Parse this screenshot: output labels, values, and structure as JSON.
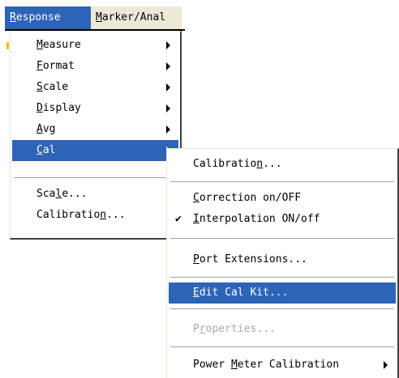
{
  "menubar": {
    "response": {
      "prefix": "",
      "accel": "R",
      "rest": "esponse"
    },
    "marker": {
      "prefix": "",
      "accel": "M",
      "rest": "arker/Anal"
    }
  },
  "response_menu": {
    "items": [
      {
        "prefix": "",
        "accel": "M",
        "rest": "easure",
        "submenu": true
      },
      {
        "prefix": "",
        "accel": "F",
        "rest": "ormat",
        "submenu": true
      },
      {
        "prefix": "",
        "accel": "S",
        "rest": "cale",
        "submenu": true
      },
      {
        "prefix": "",
        "accel": "D",
        "rest": "isplay",
        "submenu": true
      },
      {
        "prefix": "",
        "accel": "A",
        "rest": "vg",
        "submenu": true
      },
      {
        "prefix": "",
        "accel": "C",
        "rest": "al",
        "submenu": true,
        "highlighted": true
      },
      {
        "prefix": "Sca",
        "accel": "l",
        "rest": "e..."
      },
      {
        "prefix": "Calibratio",
        "accel": "n",
        "rest": "..."
      }
    ]
  },
  "cal_submenu": {
    "items": [
      {
        "prefix": "Calibratio",
        "accel": "n",
        "rest": "..."
      },
      {
        "prefix": "",
        "accel": "C",
        "rest": "orrection on/OFF"
      },
      {
        "prefix": "",
        "accel": "I",
        "rest": "nterpolation ON/off",
        "checked": true,
        "check_glyph": "✔"
      },
      {
        "prefix": "",
        "accel": "P",
        "rest": "ort Extensions..."
      },
      {
        "prefix": "",
        "accel": "E",
        "rest": "dit Cal Kit...",
        "highlighted": true
      },
      {
        "prefix": "P",
        "accel": "r",
        "rest": "operties...",
        "disabled": true
      },
      {
        "prefix": "Power ",
        "accel": "M",
        "rest": "eter Calibration",
        "submenu": true
      }
    ]
  },
  "colors": {
    "highlight": "#2d64b8",
    "menu_bg": "#ffffff",
    "disabled_text": "#a8a8a8"
  }
}
